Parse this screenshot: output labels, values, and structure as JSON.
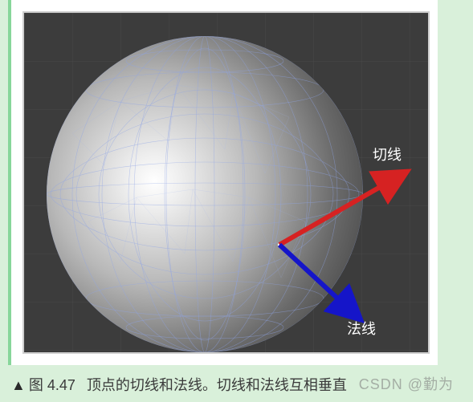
{
  "figure": {
    "number": "图 4.47",
    "caption": "顶点的切线和法线。切线和法线互相垂直",
    "marker": "▲"
  },
  "labels": {
    "tangent": "切线",
    "normal": "法线"
  },
  "colors": {
    "tangent": "#d62222",
    "normal": "#1515c9",
    "sphere_light": "#f2f2f2",
    "sphere_dark": "#5a5a5a",
    "wire": "#7a8fe0",
    "bg": "#3c3c3c",
    "grid": "#4a4a4a"
  },
  "watermark": "CSDN @勤为"
}
